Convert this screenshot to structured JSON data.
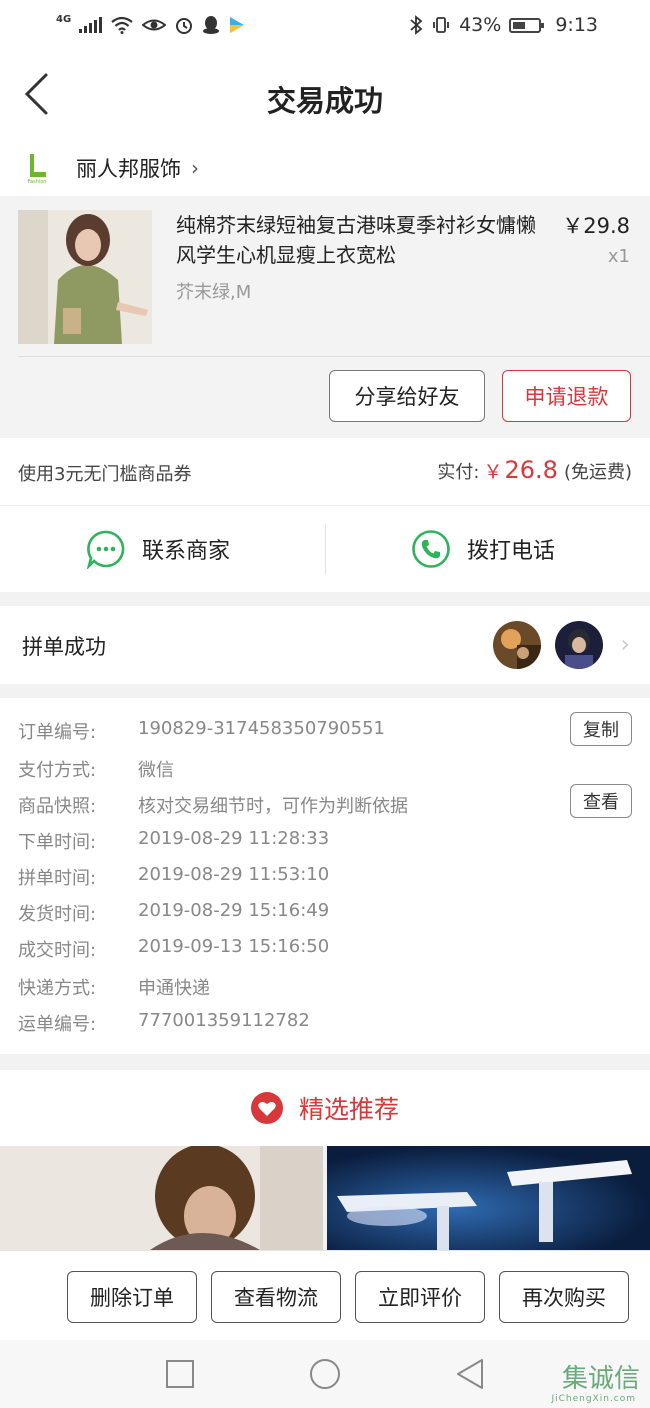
{
  "status_bar": {
    "network": "4G",
    "battery": "43%",
    "time": "9:13"
  },
  "header": {
    "title": "交易成功"
  },
  "shop": {
    "name": "丽人邦服饰"
  },
  "product": {
    "name": "纯棉芥末绿短袖复古港味夏季衬衫女慵懒风学生心机显瘦上衣宽松",
    "spec": "芥末绿,M",
    "price": "￥29.8",
    "quantity": "x1",
    "share_label": "分享给好友",
    "refund_label": "申请退款"
  },
  "payment": {
    "coupon_text": "使用3元无门槛商品券",
    "paid_label": "实付:",
    "currency": "￥",
    "amount": "26.8",
    "shipping_note": "(免运费)"
  },
  "contact": {
    "merchant_label": "联系商家",
    "phone_label": "拨打电话"
  },
  "group": {
    "label": "拼单成功"
  },
  "order_info": {
    "rows": [
      {
        "key": "订单编号:",
        "value": "190829-317458350790551"
      },
      {
        "key": "支付方式:",
        "value": "微信"
      },
      {
        "key": "商品快照:",
        "value": "核对交易细节时，可作为判断依据"
      },
      {
        "key": "下单时间:",
        "value": "2019-08-29 11:28:33"
      },
      {
        "key": "拼单时间:",
        "value": "2019-08-29 11:53:10"
      },
      {
        "key": "发货时间:",
        "value": "2019-08-29 15:16:49"
      },
      {
        "key": "成交时间:",
        "value": "2019-09-13 15:16:50"
      },
      {
        "key": "快递方式:",
        "value": "申通快递"
      },
      {
        "key": "运单编号:",
        "value": "777001359112782"
      }
    ],
    "copy_label": "复制",
    "view_label": "查看"
  },
  "recommend": {
    "title": "精选推荐"
  },
  "bottom_actions": {
    "delete": "删除订单",
    "logistics": "查看物流",
    "review": "立即评价",
    "rebuy": "再次购买"
  },
  "watermark": {
    "text": "集诚信",
    "sub": "JiChengXin.com"
  },
  "colors": {
    "accent_red": "#d8383a",
    "wechat_green": "#2fb35a"
  }
}
